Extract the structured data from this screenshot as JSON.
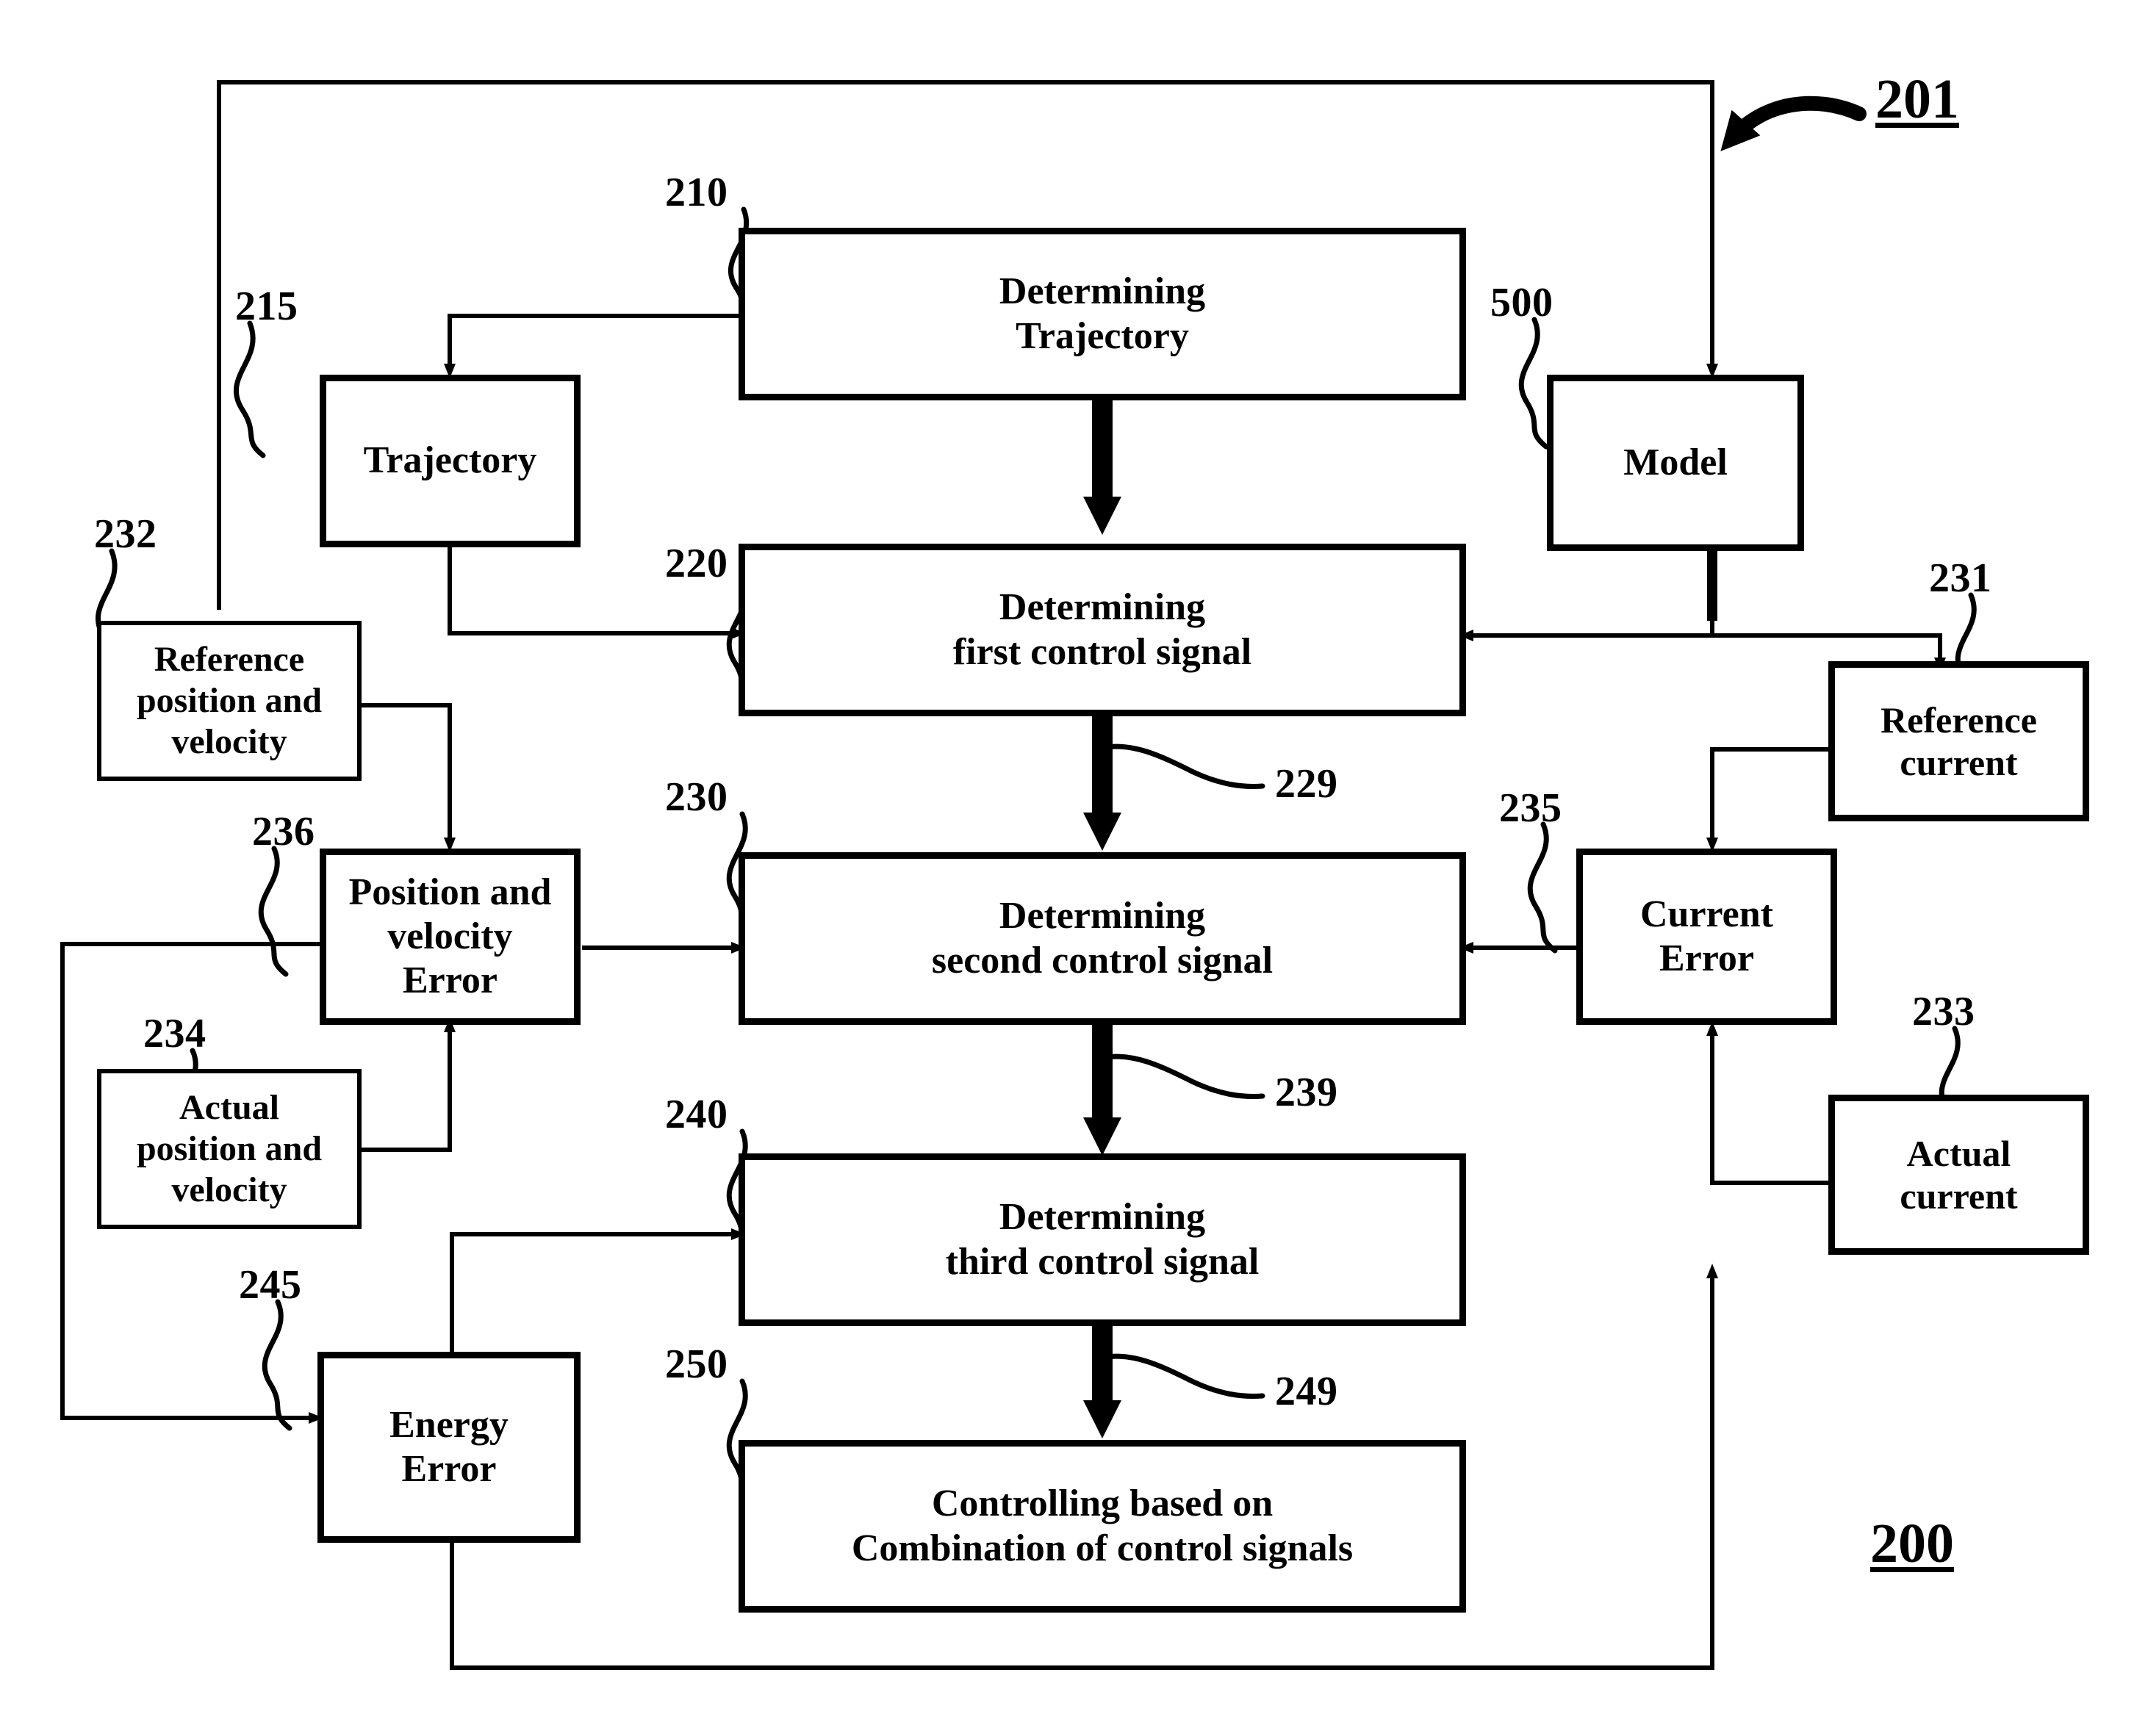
{
  "figure": {
    "number_top": "201",
    "number_bottom": "200"
  },
  "nodes": {
    "determining_trajectory": {
      "label": "Determining\nTrajectory",
      "ref": "210"
    },
    "trajectory": {
      "label": "Trajectory",
      "ref": "215"
    },
    "model": {
      "label": "Model",
      "ref": "500"
    },
    "determining_first": {
      "label": "Determining\nfirst control signal",
      "ref": "220"
    },
    "determining_second": {
      "label": "Determining\nsecond control signal",
      "ref": "230"
    },
    "determining_third": {
      "label": "Determining\nthird control signal",
      "ref": "240"
    },
    "controlling": {
      "label": "Controlling based on\nCombination of control signals",
      "ref": "250"
    },
    "reference_pos_vel": {
      "label": "Reference\nposition and\nvelocity",
      "ref": "232"
    },
    "pos_vel_error": {
      "label": "Position and\nvelocity\nError",
      "ref": "236"
    },
    "actual_pos_vel": {
      "label": "Actual\nposition and\nvelocity",
      "ref": "234"
    },
    "energy_error": {
      "label": "Energy\nError",
      "ref": "245"
    },
    "reference_current": {
      "label": "Reference\ncurrent",
      "ref": "231"
    },
    "current_error": {
      "label": "Current\nError",
      "ref": "235"
    },
    "actual_current": {
      "label": "Actual\ncurrent",
      "ref": "233"
    }
  },
  "signal_refs": {
    "first_to_second": "229",
    "second_to_third": "239",
    "third_to_control": "249"
  }
}
